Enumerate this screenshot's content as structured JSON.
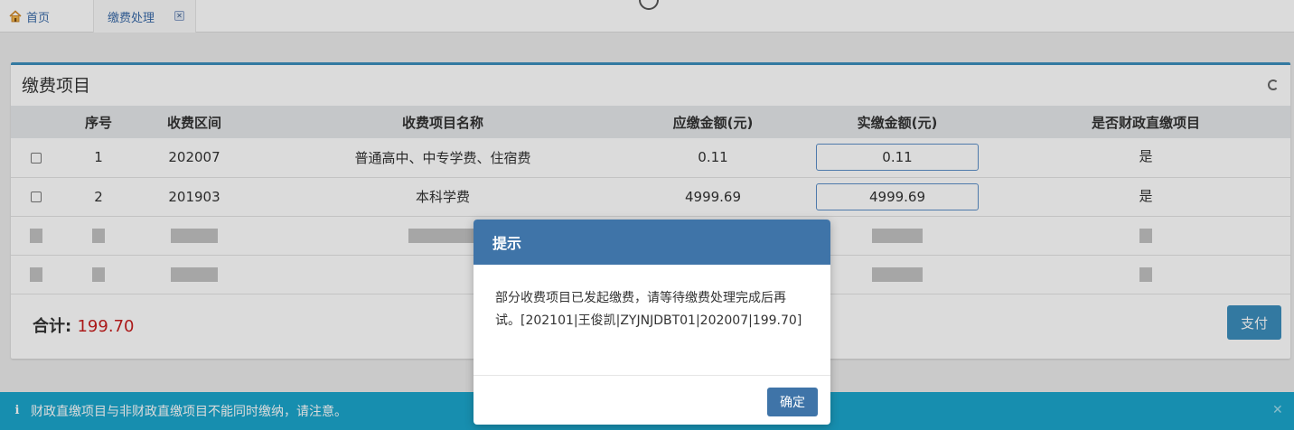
{
  "tabs": [
    {
      "label": "首页",
      "icon": "home-icon"
    },
    {
      "label": "缴费处理",
      "icon": "close-icon"
    }
  ],
  "panel": {
    "title": "缴费项目",
    "columns": [
      "",
      "序号",
      "收费区间",
      "收费项目名称",
      "应缴金额(元)",
      "实缴金额(元)",
      "是否财政直缴项目"
    ],
    "rows": [
      {
        "no": "1",
        "period": "202007",
        "name": "普通高中、中专学费、住宿费",
        "due": "0.11",
        "paid": "0.11",
        "direct": "是"
      },
      {
        "no": "2",
        "period": "201903",
        "name": "本科学费",
        "due": "4999.69",
        "paid": "4999.69",
        "direct": "是"
      }
    ],
    "total_label": "合计:",
    "total_value": "199.70",
    "pay_label": "支付"
  },
  "notice": {
    "text": "财政直缴项目与非财政直缴项目不能同时缴纳，请注意。"
  },
  "modal": {
    "title": "提示",
    "message": "部分收费项目已发起缴费，请等待缴费处理完成后再试。[202101|王俊凯|ZYJNJDBT01|202007|199.70]",
    "ok_label": "确定"
  },
  "colors": {
    "accent": "#3c8dbc",
    "modal_header": "#3f74a8",
    "notice_bg": "#1ba6cc",
    "total_value": "#c81e1e"
  }
}
